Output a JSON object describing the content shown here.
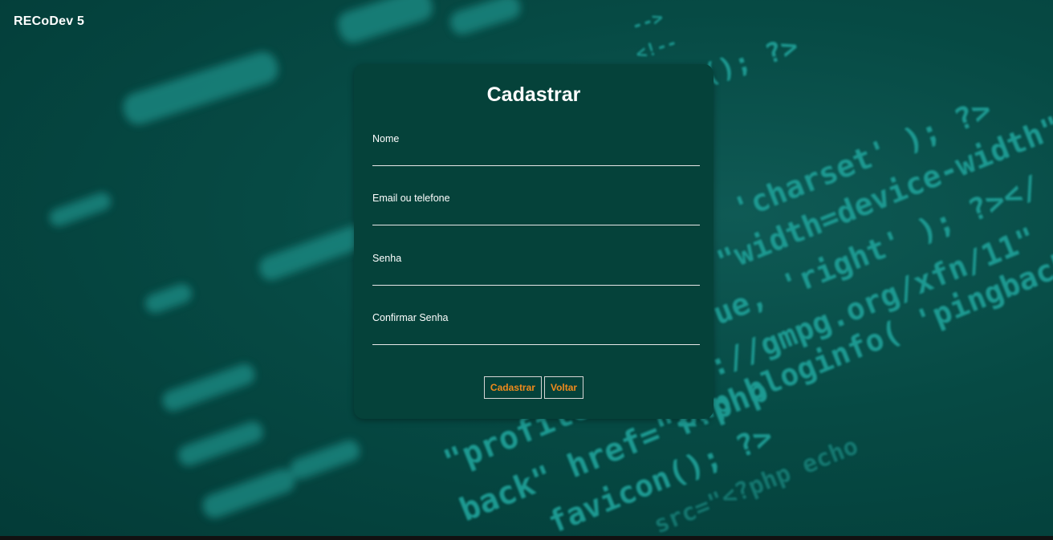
{
  "header": {
    "brand": "RECoDev 5"
  },
  "background": {
    "code_lines": [
      "-->",
      "<!--",
      "(); ?>",
      "'charset' ); ?>",
      "\"width=device-width\"",
      "ue, 'right' ); ?></",
      "://gmpg.org/xfn/11\"",
      "php bloginfo( 'pingback",
      "\"profile\" href",
      "back\" href=\"<?php",
      "favicon(); ?>",
      "src=\"<?php echo"
    ]
  },
  "form": {
    "title": "Cadastrar",
    "fields": [
      {
        "label": "Nome",
        "value": ""
      },
      {
        "label": "Email ou telefone",
        "value": ""
      },
      {
        "label": "Senha",
        "value": ""
      },
      {
        "label": "Confirmar Senha",
        "value": ""
      }
    ],
    "submit_label": "Cadastrar",
    "back_label": "Voltar"
  },
  "colors": {
    "background": "#064a44",
    "card": "#05423a",
    "button_text": "#f08a1c",
    "code_text": "#2aa69d"
  }
}
